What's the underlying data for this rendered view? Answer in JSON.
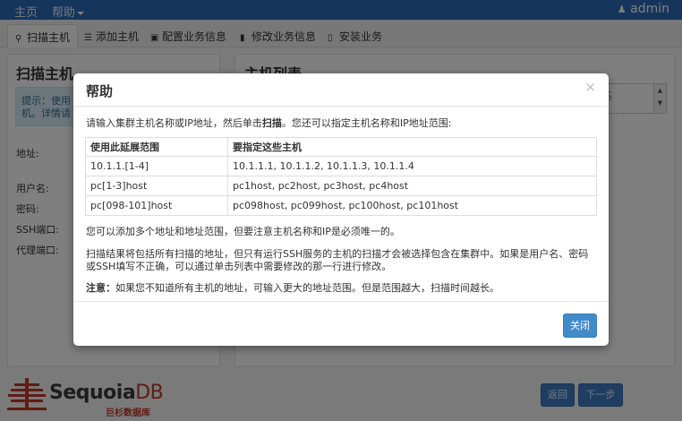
{
  "topbar": {
    "home": "主页",
    "help": "帮助",
    "user": "admin"
  },
  "tabs": [
    {
      "label": "扫描主机",
      "icon": "search-icon"
    },
    {
      "label": "添加主机",
      "icon": "database-icon"
    },
    {
      "label": "配置业务信息",
      "icon": "cube-icon"
    },
    {
      "label": "修改业务信息",
      "icon": "file-icon"
    },
    {
      "label": "安装业务",
      "icon": "mobile-icon"
    }
  ],
  "scan_panel": {
    "title": "扫描主机",
    "hint": "提示：使用\n机。详情请",
    "labels": {
      "address": "地址:",
      "username": "用户名:",
      "password": "密码:",
      "ssh_port": "SSH端口:",
      "proxy_port": "代理端口:"
    }
  },
  "host_list": {
    "title": "主机列表",
    "partial": "S"
  },
  "footer": {
    "logo_main": "Sequoia",
    "logo_db": "DB",
    "logo_sub": "巨杉数据库",
    "back": "返回",
    "next": "下一步"
  },
  "modal": {
    "title": "帮助",
    "close_icon": "×",
    "intro_before": "请输入集群主机名称或IP地址，然后单击",
    "intro_bold": "扫描",
    "intro_after": "。您还可以指定主机名称和IP地址范围:",
    "table": {
      "headers": [
        "使用此延展范围",
        "要指定这些主机"
      ],
      "rows": [
        [
          "10.1.1.[1-4]",
          "10.1.1.1, 10.1.1.2, 10.1.1.3, 10.1.1.4"
        ],
        [
          "pc[1-3]host",
          "pc1host, pc2host, pc3host, pc4host"
        ],
        [
          "pc[098-101]host",
          "pc098host, pc099host, pc100host, pc101host"
        ]
      ]
    },
    "para1": "您可以添加多个地址和地址范围，但要注意主机名称和IP是必须唯一的。",
    "para2": "扫描结果将包括所有扫描的地址，但只有运行SSH服务的主机的扫描才会被选择包含在集群中。如果是用户名、密码或SSH填写不正确，可以通过单击列表中需要修改的那一行进行修改。",
    "para3_bold": "注意：",
    "para3": "如果您不知道所有主机的地址，可输入更大的地址范围。但是范围越大，扫描时间越长。",
    "close_button": "关闭"
  }
}
